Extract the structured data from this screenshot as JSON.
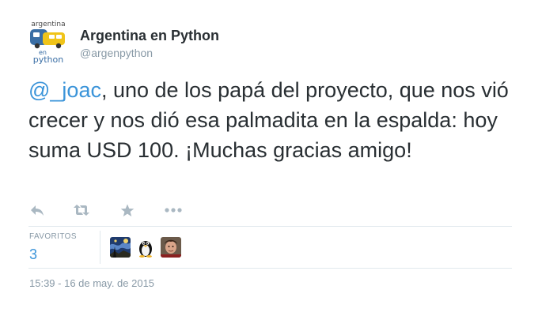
{
  "profile": {
    "name": "Argentina en Python",
    "handle": "@argenpython",
    "avatar_text_top": "argentina",
    "avatar_text_en": "en",
    "avatar_text_python": "python"
  },
  "tweet": {
    "mention": "@_joac",
    "body": ", uno de los papá del proyecto, que nos vió crecer y nos dió esa palmadita en la espalda: hoy suma USD 100. ¡Muchas gracias amigo!"
  },
  "actions": [
    {
      "name": "reply",
      "icon": "reply-icon"
    },
    {
      "name": "retweet",
      "icon": "retweet-icon"
    },
    {
      "name": "favorite",
      "icon": "star-icon"
    },
    {
      "name": "more",
      "icon": "more-icon"
    }
  ],
  "stats": {
    "favorites_label": "FAVORITOS",
    "favorites_count": "3"
  },
  "favorited_by": [
    {
      "avatar": "starry-night-avatar"
    },
    {
      "avatar": "tux-penguin-avatar"
    },
    {
      "avatar": "person-photo-avatar"
    }
  ],
  "timestamp": "15:39 - 16 de may. de 2015",
  "colors": {
    "text": "#292f33",
    "muted": "#8899a6",
    "link": "#3b94d9",
    "icon": "#aab8c2",
    "divider": "#e1e8ed"
  }
}
